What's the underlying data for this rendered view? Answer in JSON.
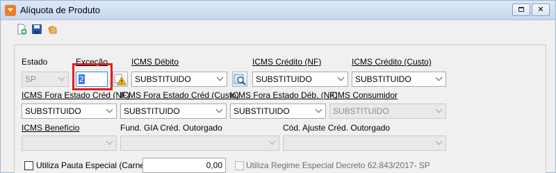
{
  "window": {
    "title": "Alíquota de Produto",
    "restore_icon": "restore-icon",
    "close_label": "✕"
  },
  "toolbar": {
    "icons": [
      "new-record-icon",
      "save-icon",
      "undo-icon"
    ]
  },
  "form": {
    "estado": {
      "label": "Estado",
      "value": "SP"
    },
    "excecao": {
      "label": "Exceção",
      "value": "2"
    },
    "icms_debito": {
      "label": "ICMS Débito",
      "value": "SUBSTITUIDO"
    },
    "icms_credito_nf": {
      "label": "ICMS Crédito (NF)",
      "value": "SUBSTITUIDO"
    },
    "icms_credito_custo": {
      "label": "ICMS Crédito (Custo)",
      "value": "SUBSTITUIDO"
    },
    "icms_fora_estado_cred_nf": {
      "label": "ICMS Fora Estado Créd (NF)",
      "value": "SUBSTITUIDO"
    },
    "icms_fora_estado_cred_custo": {
      "label": "ICMS Fora Estado Créd (Custo)",
      "value": "SUBSTITUIDO"
    },
    "icms_fora_estado_deb_nf": {
      "label": "ICMS Fora Estado Déb. (NF)",
      "value": "SUBSTITUIDO"
    },
    "icms_consumidor": {
      "label": "ICMS Consumidor",
      "value": "SUBSTITUIDO"
    },
    "icms_beneficio": {
      "label": "ICMS Benefício",
      "value": ""
    },
    "fund_gia": {
      "label": "Fund. GIA Créd. Outorgado",
      "value": ""
    },
    "cod_ajuste": {
      "label": "Cód. Ajuste Créd. Outorgado",
      "value": ""
    },
    "pauta_especial": {
      "label": "Utiliza Pauta Especial (Carnes)",
      "value": "0,00",
      "checked": false
    },
    "regime_especial": {
      "label": "Utiliza Regime Especial Decreto 62.843/2017- SP",
      "checked": false
    }
  }
}
